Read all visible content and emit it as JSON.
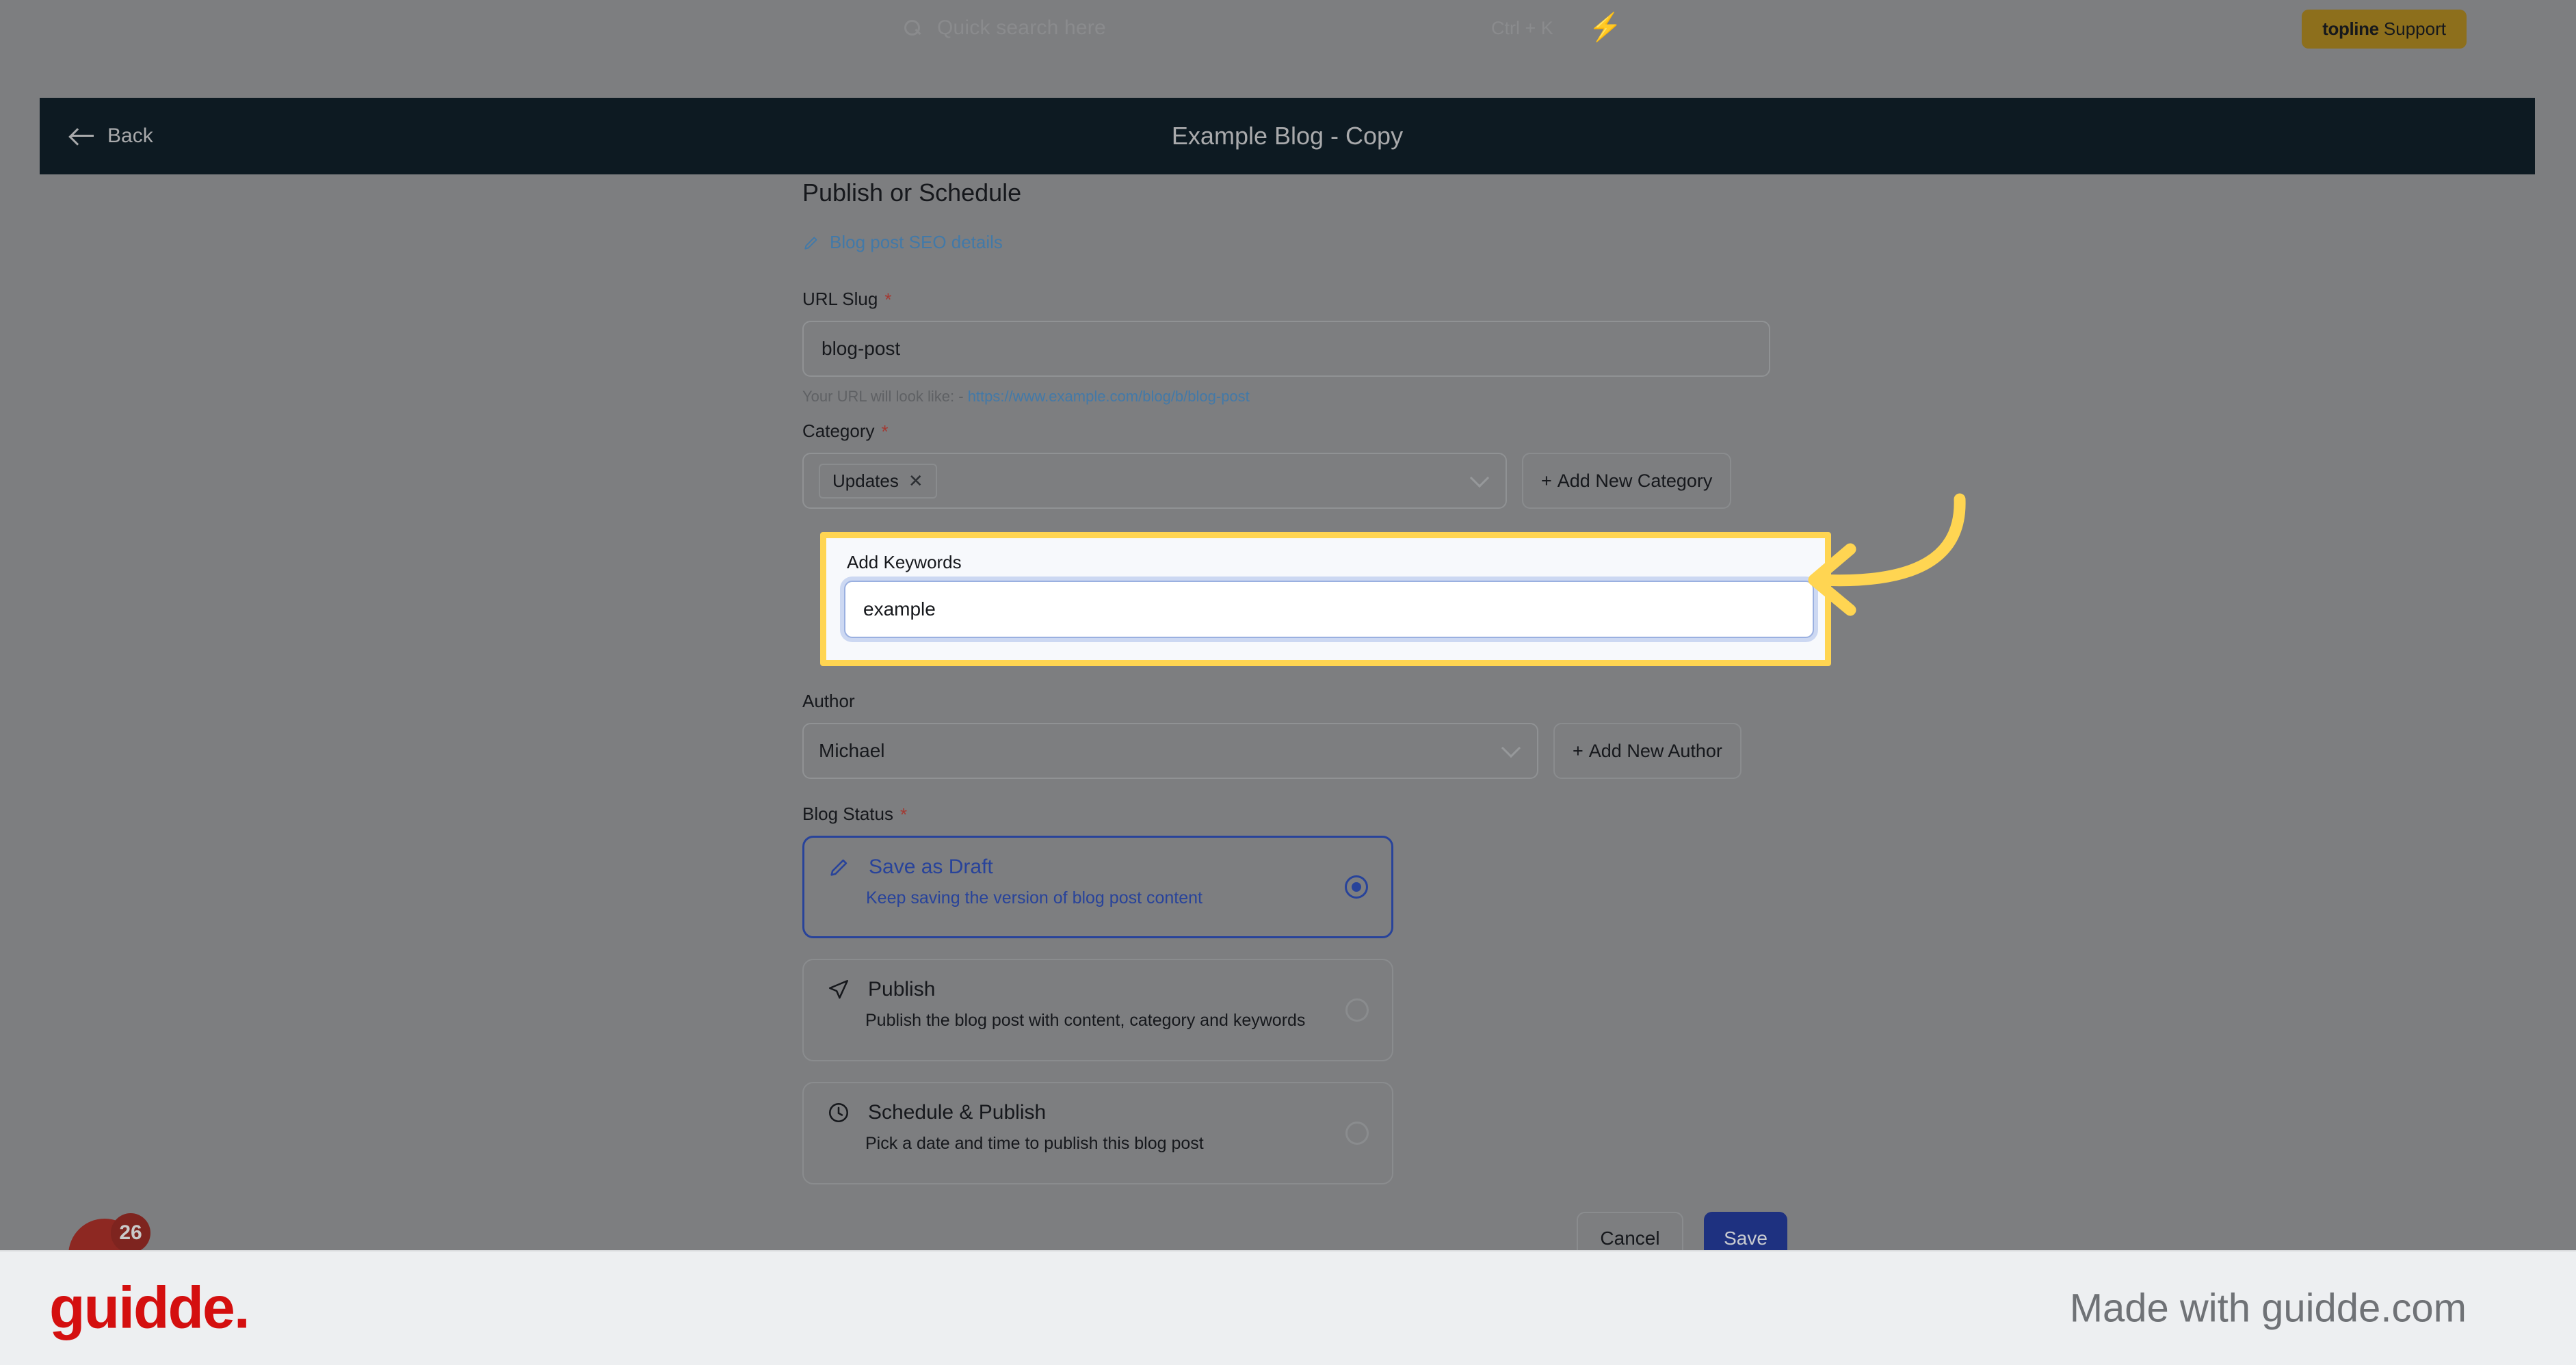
{
  "app": {
    "search": {
      "placeholder": "Quick search here",
      "shortcut": "Ctrl + K",
      "icon": "search-icon",
      "bolt_icon": "lightning-bolt-icon"
    },
    "support_chip": {
      "brand": "topline",
      "label": "Support",
      "color": "#8d6f1c"
    }
  },
  "modal": {
    "back_label": "Back",
    "title": "Example Blog - Copy",
    "header_bg": "#0d1a22"
  },
  "form": {
    "section_title": "Publish or Schedule",
    "seo_link": "Blog post SEO details",
    "url_slug": {
      "label": "URL Slug",
      "required": "*",
      "value": "blog-post",
      "hint_prefix": "Your URL will look like: - ",
      "hint_url": "https://www.example.com/blog/b/blog-post"
    },
    "category": {
      "label": "Category",
      "required": "*",
      "tag": "Updates",
      "tag_remove": "✕",
      "add_button": "Add New Category"
    },
    "keywords": {
      "label": "Add Keywords",
      "value": "example",
      "placeholder": "",
      "highlight_color": "#ffd552"
    },
    "author": {
      "label": "Author",
      "value": "Michael",
      "add_button": "Add New Author"
    },
    "blog_status": {
      "label": "Blog Status",
      "required": "*",
      "options": [
        {
          "title": "Save as Draft",
          "desc": "Keep saving the version of blog post content",
          "icon": "pencil-icon",
          "selected": true
        },
        {
          "title": "Publish",
          "desc": "Publish the blog post with content, category and keywords",
          "icon": "paper-plane-icon",
          "selected": false
        },
        {
          "title": "Schedule & Publish",
          "desc": "Pick a date and time to publish this blog post",
          "icon": "clock-icon",
          "selected": false
        }
      ]
    },
    "actions": {
      "cancel": "Cancel",
      "save": "Save",
      "save_color": "#1e3180"
    }
  },
  "chat_widget": {
    "badge": "26",
    "color": "#8d2822"
  },
  "footer": {
    "logo": "guidde.",
    "logo_color": "#d40f0f",
    "tagline": "Made with guidde.com"
  }
}
